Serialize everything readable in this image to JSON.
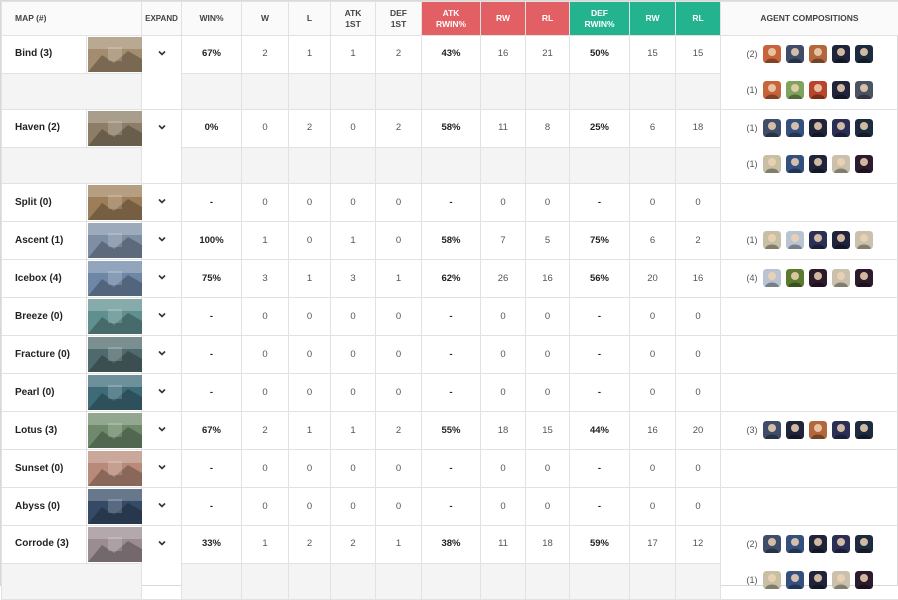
{
  "headers": {
    "map": "MAP (#)",
    "expand": "EXPAND",
    "win": "WIN%",
    "w": "W",
    "l": "L",
    "atk1st_a": "ATK",
    "atk1st_b": "1ST",
    "def1st_a": "DEF",
    "def1st_b": "1ST",
    "atkrwin_a": "ATK",
    "atkrwin_b": "RWIN%",
    "atk_rw": "RW",
    "atk_rl": "RL",
    "defrwin_a": "DEF",
    "defrwin_b": "RWIN%",
    "def_rw": "RW",
    "def_rl": "RL",
    "comps": "AGENT COMPOSITIONS"
  },
  "colors": {
    "atk_header": "#e25f63",
    "def_header": "#24b38f"
  },
  "rows": [
    {
      "map": "Bind (3)",
      "win": "67%",
      "w": "2",
      "l": "1",
      "atk1": "1",
      "def1": "2",
      "atkr": "43%",
      "arw": "16",
      "arl": "21",
      "defr": "50%",
      "drw": "15",
      "drl": "15",
      "comps": [
        {
          "count": "(2)",
          "agents": [
            "raze",
            "sage",
            "breach",
            "omen",
            "viper"
          ]
        },
        {
          "count": "(1)",
          "agents": [
            "raze",
            "skye",
            "phoenix",
            "omen",
            "fade"
          ]
        }
      ]
    },
    {
      "map": "Haven (2)",
      "win": "0%",
      "w": "0",
      "l": "2",
      "atk1": "0",
      "def1": "2",
      "atkr": "58%",
      "arw": "11",
      "arl": "8",
      "defr": "25%",
      "drw": "6",
      "drl": "18",
      "comps": [
        {
          "count": "(1)",
          "agents": [
            "sage",
            "jett",
            "omen",
            "omen2",
            "viper"
          ]
        },
        {
          "count": "(1)",
          "agents": [
            "cypher",
            "jett",
            "omen",
            "sova",
            "reyna"
          ]
        }
      ]
    },
    {
      "map": "Split (0)",
      "win": "-",
      "w": "0",
      "l": "0",
      "atk1": "0",
      "def1": "0",
      "atkr": "-",
      "arw": "0",
      "arl": "0",
      "defr": "-",
      "drw": "0",
      "drl": "0",
      "comps": []
    },
    {
      "map": "Ascent (1)",
      "win": "100%",
      "w": "1",
      "l": "0",
      "atk1": "1",
      "def1": "0",
      "atkr": "58%",
      "arw": "7",
      "arl": "5",
      "defr": "75%",
      "drw": "6",
      "drl": "2",
      "comps": [
        {
          "count": "(1)",
          "agents": [
            "cypher",
            "jett2",
            "omen2",
            "omen",
            "sova"
          ]
        }
      ]
    },
    {
      "map": "Icebox (4)",
      "win": "75%",
      "w": "3",
      "l": "1",
      "atk1": "3",
      "def1": "1",
      "atkr": "62%",
      "arw": "26",
      "arl": "16",
      "defr": "56%",
      "drw": "20",
      "drl": "16",
      "comps": [
        {
          "count": "(4)",
          "agents": [
            "jett2",
            "killjoy",
            "reyna",
            "sova",
            "reyna"
          ]
        }
      ]
    },
    {
      "map": "Breeze (0)",
      "win": "-",
      "w": "0",
      "l": "0",
      "atk1": "0",
      "def1": "0",
      "atkr": "-",
      "arw": "0",
      "arl": "0",
      "defr": "-",
      "drw": "0",
      "drl": "0",
      "comps": []
    },
    {
      "map": "Fracture (0)",
      "win": "-",
      "w": "0",
      "l": "0",
      "atk1": "0",
      "def1": "0",
      "atkr": "-",
      "arw": "0",
      "arl": "0",
      "defr": "-",
      "drw": "0",
      "drl": "0",
      "comps": []
    },
    {
      "map": "Pearl (0)",
      "win": "-",
      "w": "0",
      "l": "0",
      "atk1": "0",
      "def1": "0",
      "atkr": "-",
      "arw": "0",
      "arl": "0",
      "defr": "-",
      "drw": "0",
      "drl": "0",
      "comps": []
    },
    {
      "map": "Lotus (3)",
      "win": "67%",
      "w": "2",
      "l": "1",
      "atk1": "1",
      "def1": "2",
      "atkr": "55%",
      "arw": "18",
      "arl": "15",
      "defr": "44%",
      "drw": "16",
      "drl": "20",
      "comps": [
        {
          "count": "(3)",
          "agents": [
            "sage",
            "omen",
            "breach",
            "omen2",
            "viper"
          ]
        }
      ]
    },
    {
      "map": "Sunset (0)",
      "win": "-",
      "w": "0",
      "l": "0",
      "atk1": "0",
      "def1": "0",
      "atkr": "-",
      "arw": "0",
      "arl": "0",
      "defr": "-",
      "drw": "0",
      "drl": "0",
      "comps": []
    },
    {
      "map": "Abyss (0)",
      "win": "-",
      "w": "0",
      "l": "0",
      "atk1": "0",
      "def1": "0",
      "atkr": "-",
      "arw": "0",
      "arl": "0",
      "defr": "-",
      "drw": "0",
      "drl": "0",
      "comps": []
    },
    {
      "map": "Corrode (3)",
      "win": "33%",
      "w": "1",
      "l": "2",
      "atk1": "2",
      "def1": "1",
      "atkr": "38%",
      "arw": "11",
      "arl": "18",
      "defr": "59%",
      "drw": "17",
      "drl": "12",
      "comps": [
        {
          "count": "(2)",
          "agents": [
            "sage",
            "jett",
            "omen",
            "omen2",
            "viper"
          ]
        },
        {
          "count": "(1)",
          "agents": [
            "cypher",
            "jett",
            "omen",
            "sova",
            "reyna"
          ]
        }
      ]
    }
  ],
  "agent_colors": {
    "raze": "#c7643a",
    "sage": "#3f4d6b",
    "breach": "#b3683c",
    "omen": "#20243a",
    "omen2": "#2b2f55",
    "viper": "#1d2b3e",
    "skye": "#7fa35a",
    "phoenix": "#b8442c",
    "fade": "#4b5262",
    "jett": "#34507e",
    "jett2": "#b9c3d2",
    "cypher": "#c7c0a5",
    "sova": "#c9c1ad",
    "reyna": "#2c1b2c",
    "killjoy": "#5b7a2f"
  },
  "map_colors": {
    "Bind (3)": "#a38d6e",
    "Haven (2)": "#8d7d66",
    "Split (0)": "#9c7e58",
    "Ascent (1)": "#7d8ea5",
    "Icebox (4)": "#6e87a6",
    "Breeze (0)": "#5f8f8f",
    "Fracture (0)": "#4f6a6c",
    "Pearl (0)": "#3e6b78",
    "Lotus (3)": "#6e8a6a",
    "Sunset (0)": "#b98a7a",
    "Abyss (0)": "#344a66",
    "Corrode (3)": "#9a8c92"
  }
}
